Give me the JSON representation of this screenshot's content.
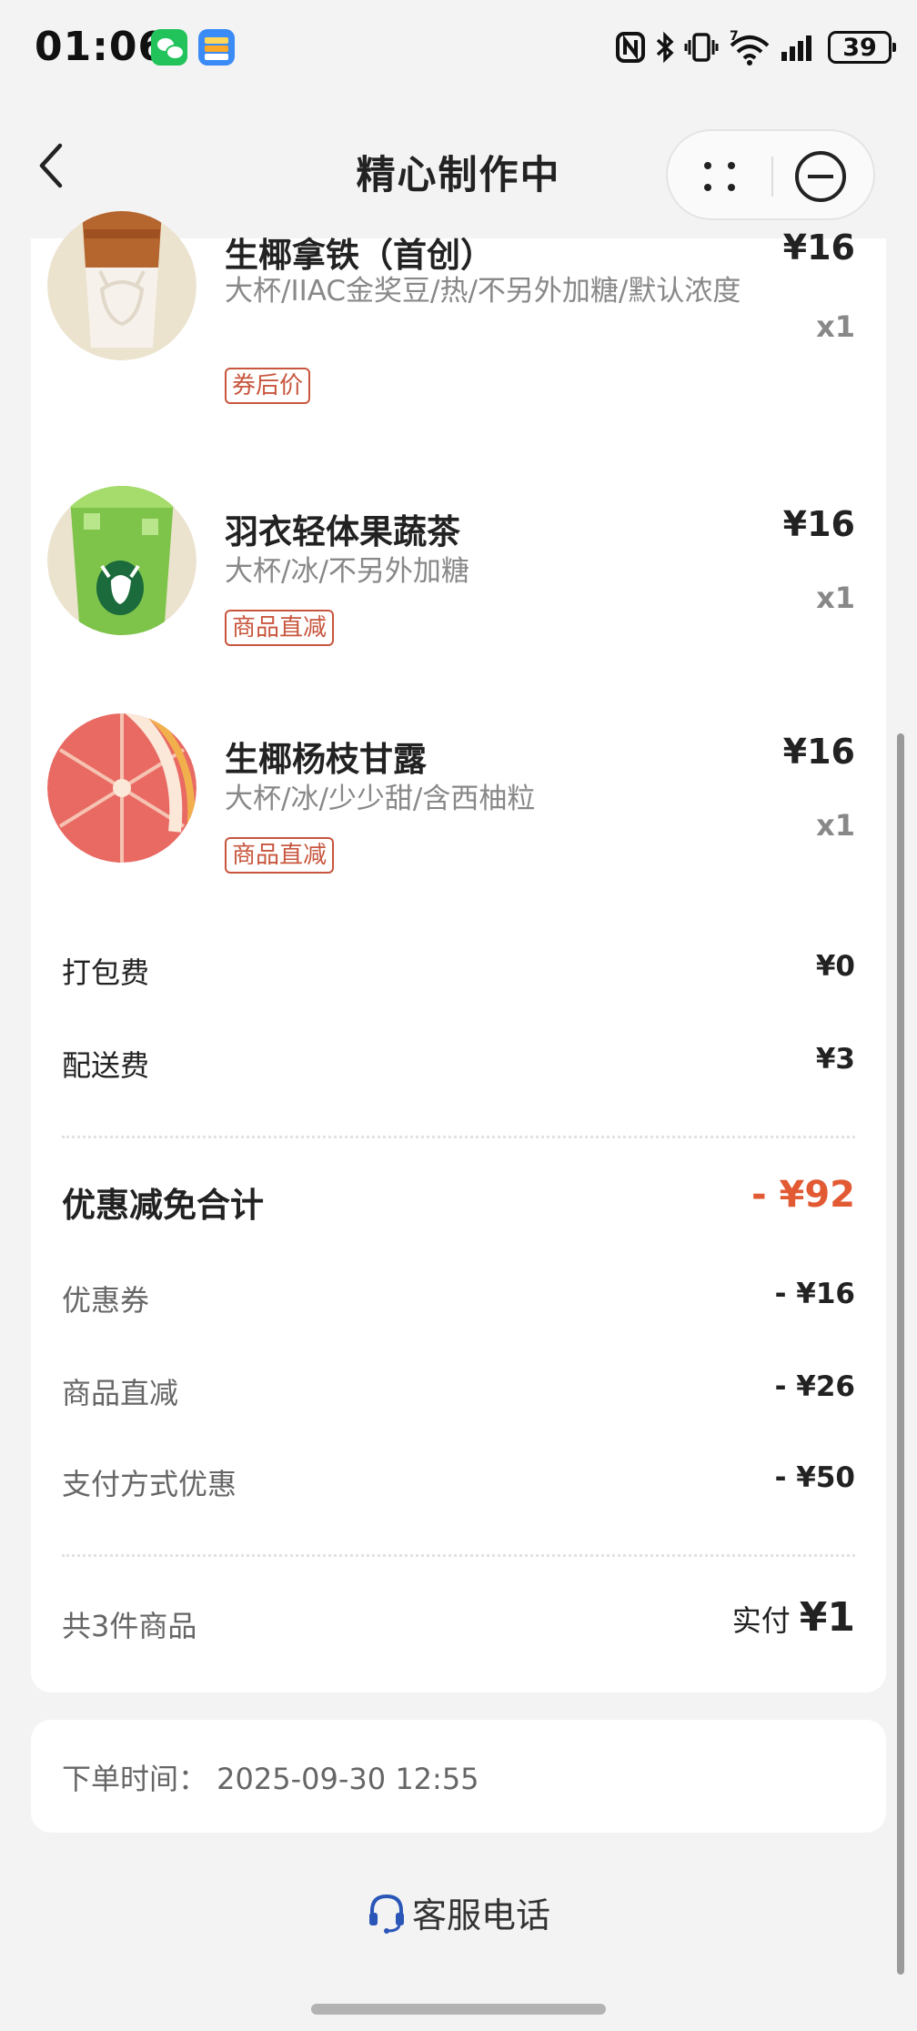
{
  "status_bar": {
    "time": "01:06",
    "battery": "39",
    "signal_extra": "7",
    "icons": [
      "wechat-icon",
      "wallet-icon",
      "nfc-icon",
      "bluetooth-icon",
      "vibrate-icon",
      "wifi-icon",
      "cellular-signal-icon",
      "battery-icon"
    ]
  },
  "nav": {
    "title": "精心制作中",
    "back_icon": "chevron-left-icon",
    "more_icon": "more-dots-icon",
    "close_icon": "minus-circle-icon"
  },
  "items": [
    {
      "name": "生椰拿铁（首创）",
      "spec": "大杯/IIAC金奖豆/热/不另外加糖/默认浓度",
      "tag": "券后价",
      "price": "¥16",
      "qty": "x1",
      "image": "coconut-latte-cup"
    },
    {
      "name": "羽衣轻体果蔬茶",
      "spec": "大杯/冰/不另外加糖",
      "tag": "商品直减",
      "price": "¥16",
      "qty": "x1",
      "image": "kale-tea-cup"
    },
    {
      "name": "生椰杨枝甘露",
      "spec": "大杯/冰/少少甜/含西柚粒",
      "tag": "商品直减",
      "price": "¥16",
      "qty": "x1",
      "image": "grapefruit-slice"
    }
  ],
  "fees": {
    "packing_label": "打包费",
    "packing_value": "¥0",
    "delivery_label": "配送费",
    "delivery_value": "¥3"
  },
  "discounts": {
    "total_label": "优惠减免合计",
    "total_value": "- ¥92",
    "coupon_label": "优惠券",
    "coupon_value": "- ¥16",
    "direct_label": "商品直减",
    "direct_value": "- ¥26",
    "payment_label": "支付方式优惠",
    "payment_value": "- ¥50"
  },
  "summary": {
    "count": "共3件商品",
    "paid_label": "实付",
    "paid_amount": "¥1"
  },
  "order_time": "下单时间：  2025-09-30 12:55",
  "service": {
    "label": "客服电话",
    "icon": "headset-icon"
  },
  "colors": {
    "accent": "#e25a33",
    "tag": "#c8563e",
    "background": "#f3f3f3"
  }
}
